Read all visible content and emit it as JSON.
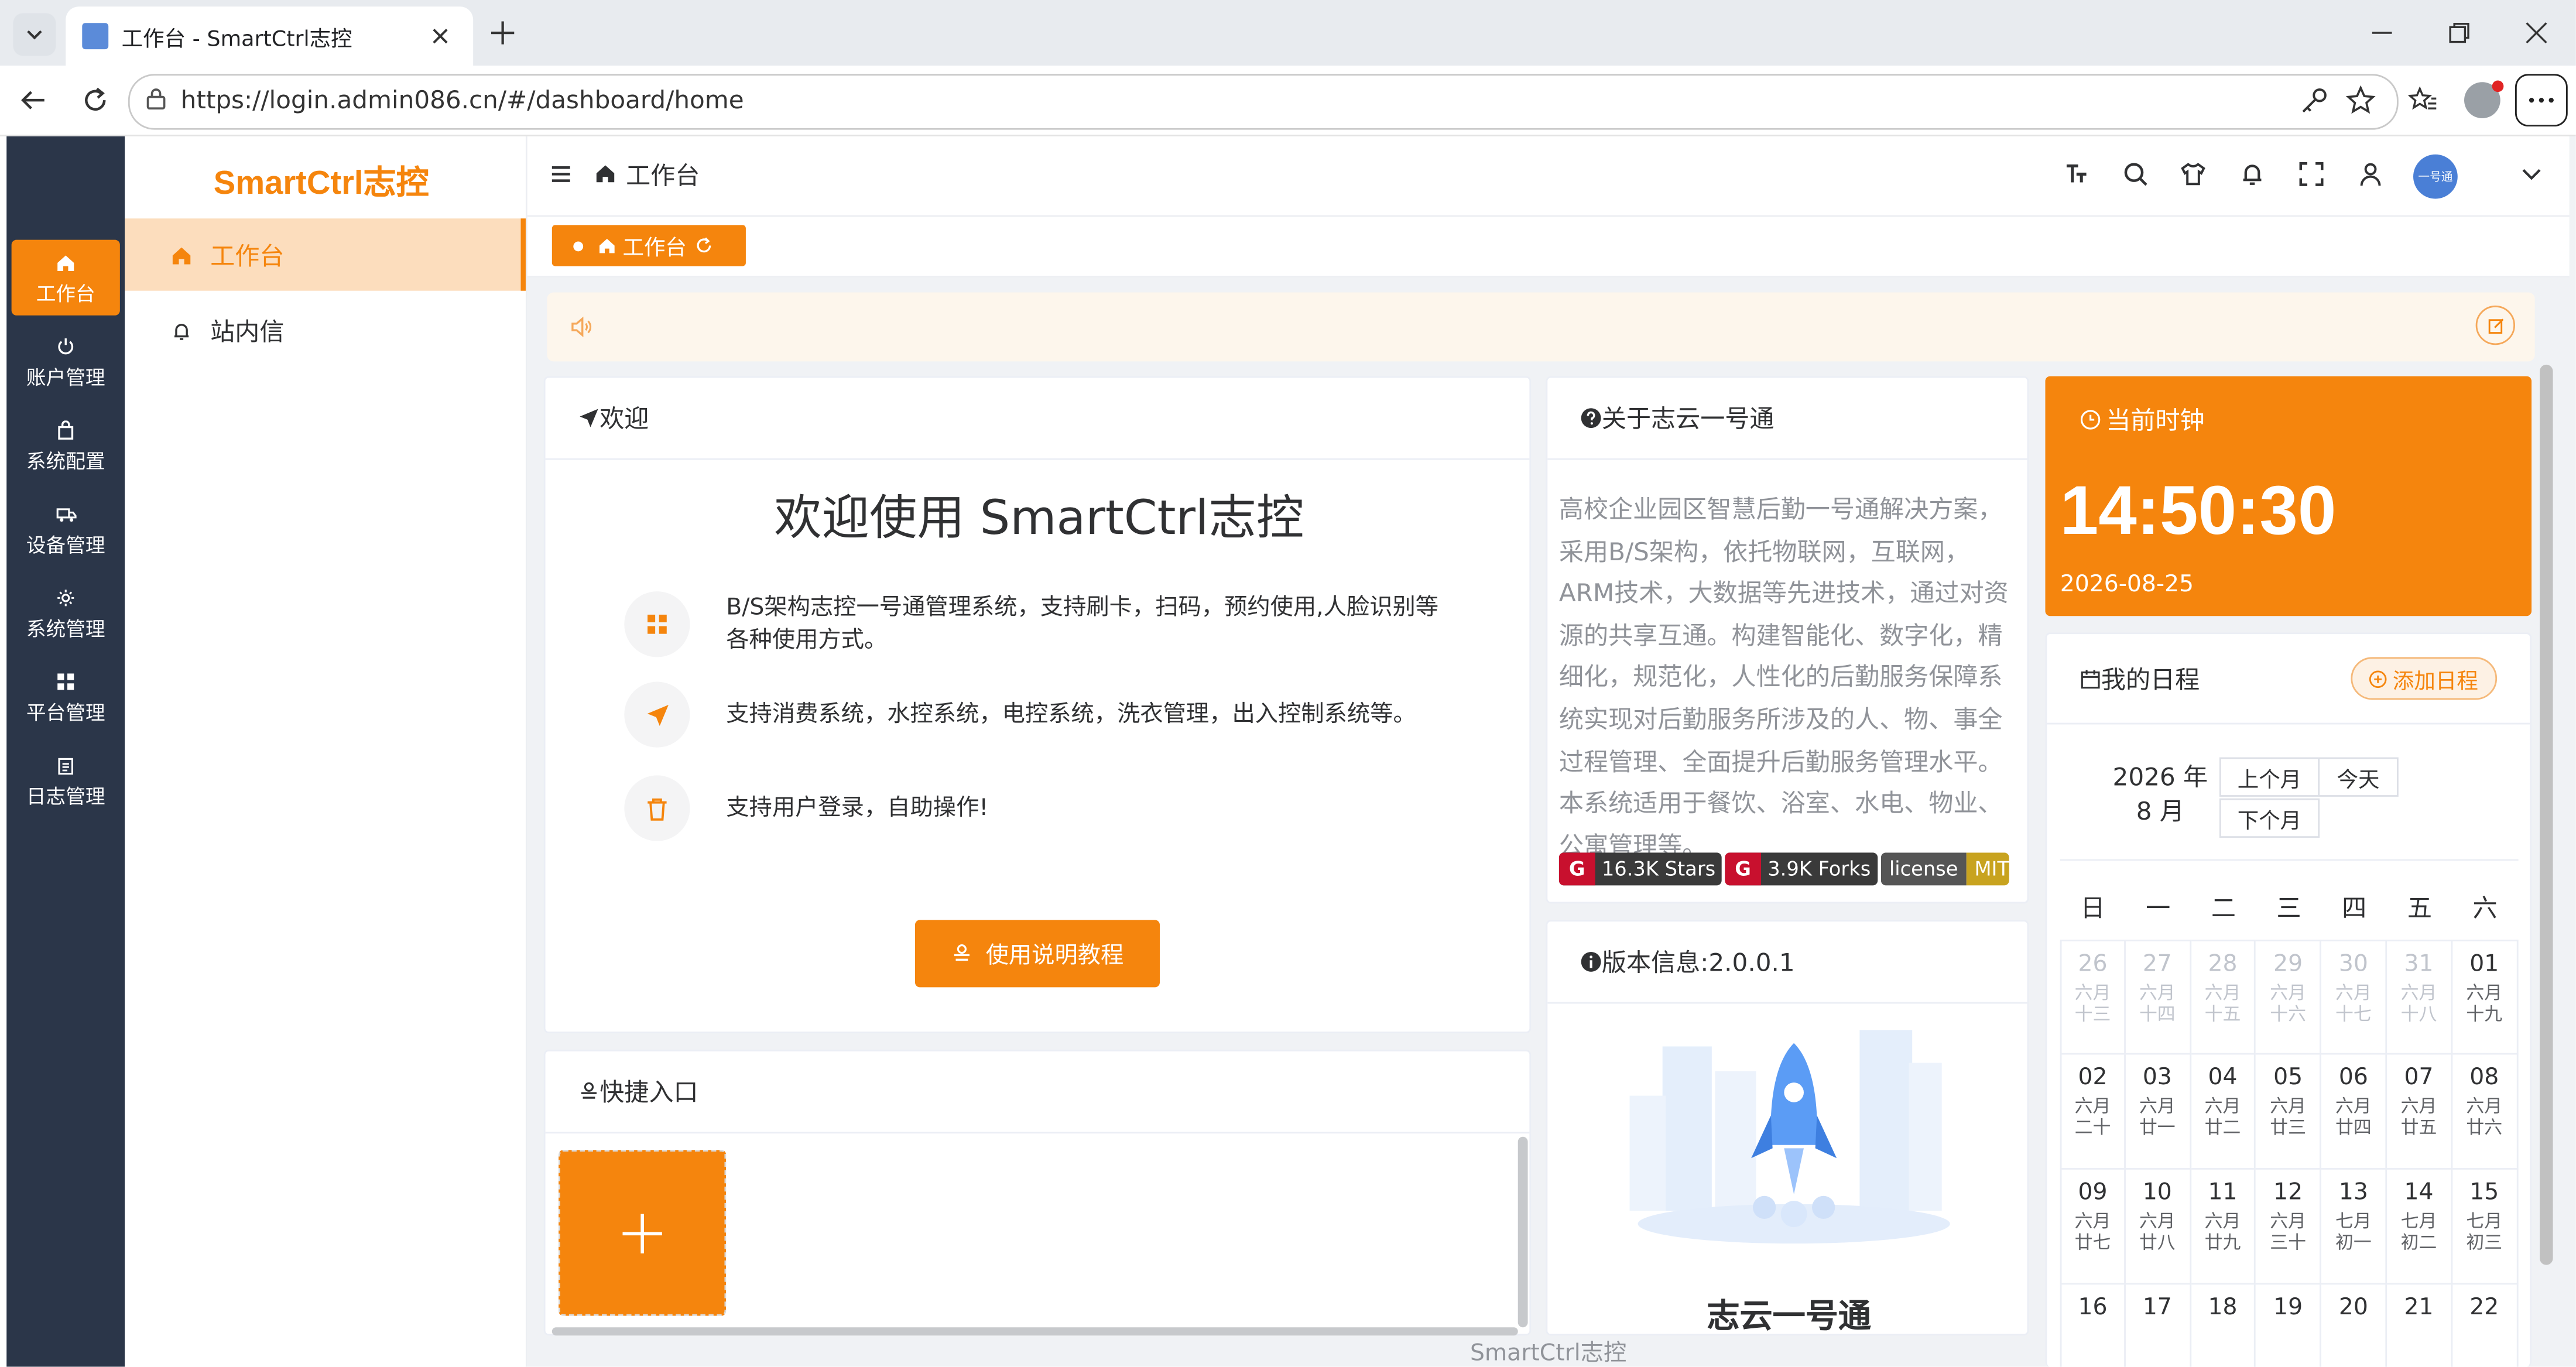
{
  "browser": {
    "tab_title": "工作台 - SmartCtrl志控",
    "url": "https://login.admin086.cn/#/dashboard/home"
  },
  "app": {
    "logo": "SmartCtrl志控",
    "rail": [
      {
        "label": "工作台",
        "icon": "home-icon"
      },
      {
        "label": "账户管理",
        "icon": "power-icon"
      },
      {
        "label": "系统配置",
        "icon": "bag-icon"
      },
      {
        "label": "设备管理",
        "icon": "truck-icon"
      },
      {
        "label": "系统管理",
        "icon": "gear-icon"
      },
      {
        "label": "平台管理",
        "icon": "grid-icon"
      },
      {
        "label": "日志管理",
        "icon": "log-icon"
      }
    ],
    "submenu": [
      {
        "label": "工作台",
        "icon": "home-icon"
      },
      {
        "label": "站内信",
        "icon": "bell-icon"
      }
    ],
    "breadcrumb": "工作台",
    "active_tag": "工作台",
    "avatar_text": "一号通",
    "accent_color": "#f5850d"
  },
  "welcome": {
    "title": "欢迎",
    "heading": "欢迎使用 SmartCtrl志控",
    "features": [
      {
        "icon": "grid-icon",
        "text": "B/S架构志控一号通管理系统，支持刷卡，扫码，预约使用,人脸识别等各种使用方式。"
      },
      {
        "icon": "send-icon",
        "text": "支持消费系统，水控系统，电控系统，洗衣管理，出入控制系统等。"
      },
      {
        "icon": "trash-icon",
        "text": "支持用户登录，自助操作!"
      }
    ],
    "button": "使用说明教程"
  },
  "shortcut": {
    "title": "快捷入口"
  },
  "about": {
    "title": "关于志云一号通",
    "text": "高校企业园区智慧后勤一号通解决方案，采用B/S架构，依托物联网，互联网，ARM技术，大数据等先进技术，通过对资源的共享互通。构建智能化、数字化，精细化，规范化，人性化的后勤服务保障系统实现对后勤服务所涉及的人、物、事全过程管理、全面提升后勤服务管理水平。本系统适用于餐饮、浴室、水电、物业、公寓管理等。",
    "badges": [
      {
        "label": "16.3K Stars",
        "color": "#3a3a3a"
      },
      {
        "label": "3.9K Forks",
        "color": "#3a3a3a"
      },
      {
        "left": "license",
        "right": "MIT",
        "color": "#c8a31f"
      }
    ]
  },
  "version": {
    "title": "版本信息:2.0.0.1",
    "product": "志云一号通"
  },
  "clock": {
    "title": "当前时钟",
    "time": "14:50:30",
    "date": "2026-08-25"
  },
  "schedule": {
    "title": "我的日程",
    "add_button": "添加日程",
    "month_label": "2026 年 8 月",
    "prev_month": "上个月",
    "today": "今天",
    "next_month": "下个月",
    "weekdays": [
      "日",
      "一",
      "二",
      "三",
      "四",
      "五",
      "六"
    ],
    "days": [
      {
        "d": "26",
        "l1": "六月",
        "l2": "十三",
        "prev": true
      },
      {
        "d": "27",
        "l1": "六月",
        "l2": "十四",
        "prev": true
      },
      {
        "d": "28",
        "l1": "六月",
        "l2": "十五",
        "prev": true
      },
      {
        "d": "29",
        "l1": "六月",
        "l2": "十六",
        "prev": true
      },
      {
        "d": "30",
        "l1": "六月",
        "l2": "十七",
        "prev": true
      },
      {
        "d": "31",
        "l1": "六月",
        "l2": "十八",
        "prev": true
      },
      {
        "d": "01",
        "l1": "六月",
        "l2": "十九"
      },
      {
        "d": "02",
        "l1": "六月",
        "l2": "二十"
      },
      {
        "d": "03",
        "l1": "六月",
        "l2": "廿一"
      },
      {
        "d": "04",
        "l1": "六月",
        "l2": "廿二"
      },
      {
        "d": "05",
        "l1": "六月",
        "l2": "廿三"
      },
      {
        "d": "06",
        "l1": "六月",
        "l2": "廿四"
      },
      {
        "d": "07",
        "l1": "六月",
        "l2": "廿五"
      },
      {
        "d": "08",
        "l1": "六月",
        "l2": "廿六"
      },
      {
        "d": "09",
        "l1": "六月",
        "l2": "廿七"
      },
      {
        "d": "10",
        "l1": "六月",
        "l2": "廿八"
      },
      {
        "d": "11",
        "l1": "六月",
        "l2": "廿九"
      },
      {
        "d": "12",
        "l1": "六月",
        "l2": "三十"
      },
      {
        "d": "13",
        "l1": "七月",
        "l2": "初一"
      },
      {
        "d": "14",
        "l1": "七月",
        "l2": "初二"
      },
      {
        "d": "15",
        "l1": "七月",
        "l2": "初三"
      },
      {
        "d": "16",
        "l1": "",
        "l2": ""
      },
      {
        "d": "17",
        "l1": "",
        "l2": ""
      },
      {
        "d": "18",
        "l1": "",
        "l2": ""
      },
      {
        "d": "19",
        "l1": "",
        "l2": ""
      },
      {
        "d": "20",
        "l1": "",
        "l2": ""
      },
      {
        "d": "21",
        "l1": "",
        "l2": ""
      },
      {
        "d": "22",
        "l1": "",
        "l2": ""
      }
    ]
  },
  "footer": "SmartCtrl志控"
}
